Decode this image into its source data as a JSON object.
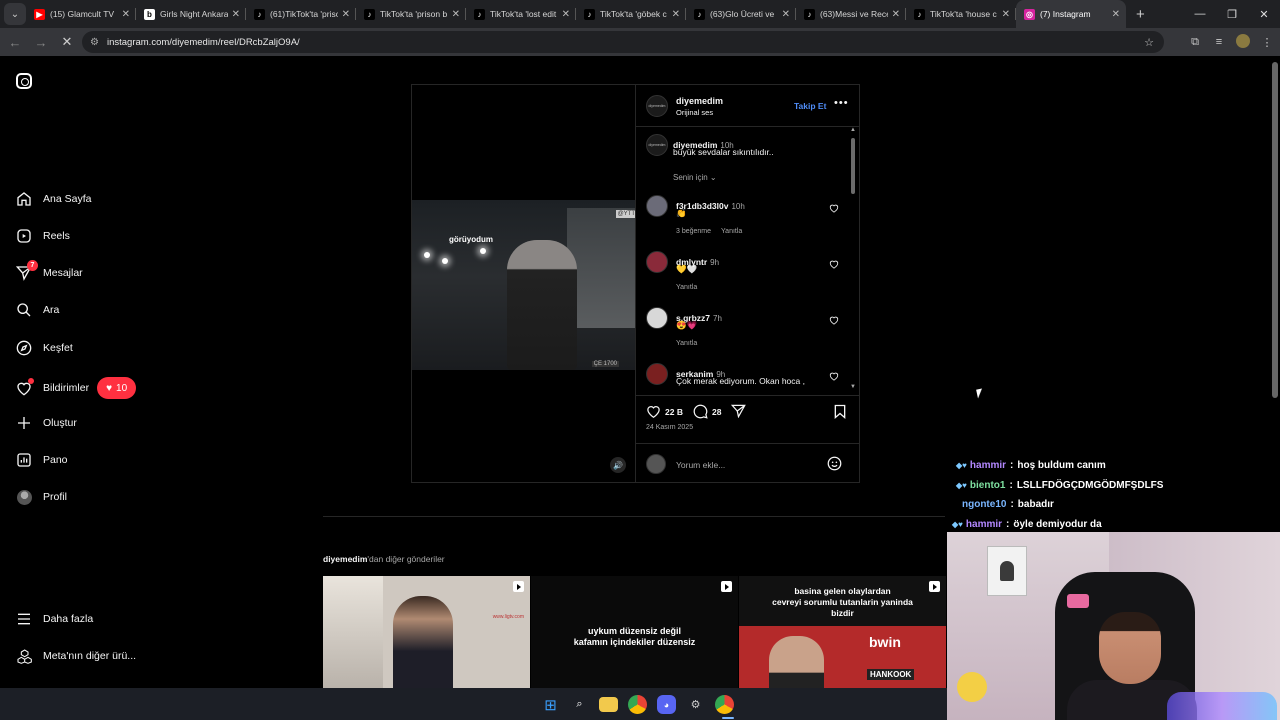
{
  "browser": {
    "tabs": [
      {
        "title": "(15) Glamcult TV",
        "fav_color": "#ff0000",
        "fav_glyph": "▶",
        "icon": "youtube-icon"
      },
      {
        "title": "Girls Night Ankara",
        "fav_color": "#ffffff",
        "fav_glyph": "b",
        "icon": "bumble-icon"
      },
      {
        "title": "(61)TikTok'ta 'prison",
        "fav_color": "#000000",
        "fav_glyph": "♪",
        "icon": "tiktok-icon"
      },
      {
        "title": "TikTok'ta 'prison b",
        "fav_color": "#000000",
        "fav_glyph": "♪",
        "icon": "tiktok-icon"
      },
      {
        "title": "TikTok'ta 'lost edit",
        "fav_color": "#000000",
        "fav_glyph": "♪",
        "icon": "tiktok-icon"
      },
      {
        "title": "TikTok'ta 'göbek c",
        "fav_color": "#000000",
        "fav_glyph": "♪",
        "icon": "tiktok-icon"
      },
      {
        "title": "(63)Glo Ücreti ve",
        "fav_color": "#000000",
        "fav_glyph": "♪",
        "icon": "tiktok-icon"
      },
      {
        "title": "(63)Messi ve Rece",
        "fav_color": "#000000",
        "fav_glyph": "♪",
        "icon": "tiktok-icon"
      },
      {
        "title": "TikTok'ta 'house c",
        "fav_color": "#000000",
        "fav_glyph": "♪",
        "icon": "tiktok-icon"
      },
      {
        "title": "(7) Instagram",
        "fav_color": "#d6249f",
        "fav_glyph": "◎",
        "icon": "instagram-icon",
        "active": true
      }
    ],
    "url": "instagram.com/diyemedim/reel/DRcbZaljO9A/"
  },
  "sidebar": {
    "items": [
      {
        "label": "Ana Sayfa",
        "icon": "home-icon"
      },
      {
        "label": "Reels",
        "icon": "reels-icon"
      },
      {
        "label": "Mesajlar",
        "icon": "messages-icon",
        "badge": "7"
      },
      {
        "label": "Ara",
        "icon": "search-icon"
      },
      {
        "label": "Keşfet",
        "icon": "compass-icon"
      },
      {
        "label": "Bildirimler",
        "icon": "heart-icon",
        "pill_count": "10"
      },
      {
        "label": "Oluştur",
        "icon": "plus-icon"
      },
      {
        "label": "Pano",
        "icon": "dashboard-icon"
      },
      {
        "label": "Profil",
        "icon": "profile-avatar"
      }
    ],
    "bottom": [
      {
        "label": "Daha fazla",
        "icon": "menu-icon"
      },
      {
        "label": "Meta'nın diğer ürü...",
        "icon": "meta-apps-icon"
      }
    ]
  },
  "post": {
    "video_caption": "görüyodum",
    "video_tag": "@YTT",
    "video_stamp": "ÇE 1700",
    "author": "diyemedim",
    "audio": "Orijinal ses",
    "follow_label": "Takip Et",
    "caption_user": "diyemedim",
    "caption_time": "10h",
    "caption_text": "büyük sevdalar sıkıntılıdır..",
    "sort_label": "Senin için",
    "comments": [
      {
        "user": "f3r1db3d3l0v",
        "time": "10h",
        "text": "👏",
        "likes": "3 beğenme",
        "reply": "Yanıtla",
        "avatar_color": "#6b6b78"
      },
      {
        "user": "dmlyntr",
        "time": "9h",
        "text": "💛🤍",
        "likes": "",
        "reply": "Yanıtla",
        "avatar_color": "#8a2a3a"
      },
      {
        "user": "s.grbzz7",
        "time": "7h",
        "text": "😍💗",
        "likes": "",
        "reply": "Yanıtla",
        "avatar_color": "#d8d8d8"
      },
      {
        "user": "serkanim",
        "time": "9h",
        "text": "Çok merak ediyorum. Okan hoca ,",
        "likes": "",
        "reply": "",
        "avatar_color": "#7a2020"
      }
    ],
    "likes_count": "22 B",
    "comments_count": "28",
    "date": "24 Kasım 2025",
    "comment_placeholder": "Yorum ekle..."
  },
  "more_posts": {
    "owner": "diyemedim",
    "suffix": "'dan diğer gönderiler",
    "thumbs": [
      {
        "caption": "",
        "bg": "#cfc8c0"
      },
      {
        "caption": "uykum düzensiz değil\nkafamın içindekiler düzensiz",
        "bg": "#0a0a0a"
      },
      {
        "caption": "basina gelen olaylardan\ncevreyi sorumlu tutanlarin yaninda\nbizdir",
        "bg": "#111"
      }
    ],
    "thumb_watermark": "www.ligtv.com",
    "sponsor_text_1": "bwin",
    "sponsor_text_2": "HANKOOK"
  },
  "stream_chat": [
    {
      "user": "hammir",
      "message": "hoş buldum canım",
      "user_color": "#b388ff",
      "icons": true
    },
    {
      "user": "bientо1",
      "message": "LSLLFDÖGÇDMGÖDMFŞDLFS",
      "user_color": "#7fe0a0",
      "icons": true
    },
    {
      "user": "ngonte10",
      "message": "babadır",
      "user_color": "#7ab6ff",
      "icons": false
    },
    {
      "user": "hammir",
      "message": "öyle demiyodur da",
      "user_color": "#b388ff",
      "icons": true
    }
  ],
  "taskbar": {
    "apps": [
      "windows-start-icon",
      "search-icon",
      "file-explorer-icon",
      "chrome-icon",
      "discord-icon",
      "settings-icon",
      "chrome-icon"
    ]
  }
}
